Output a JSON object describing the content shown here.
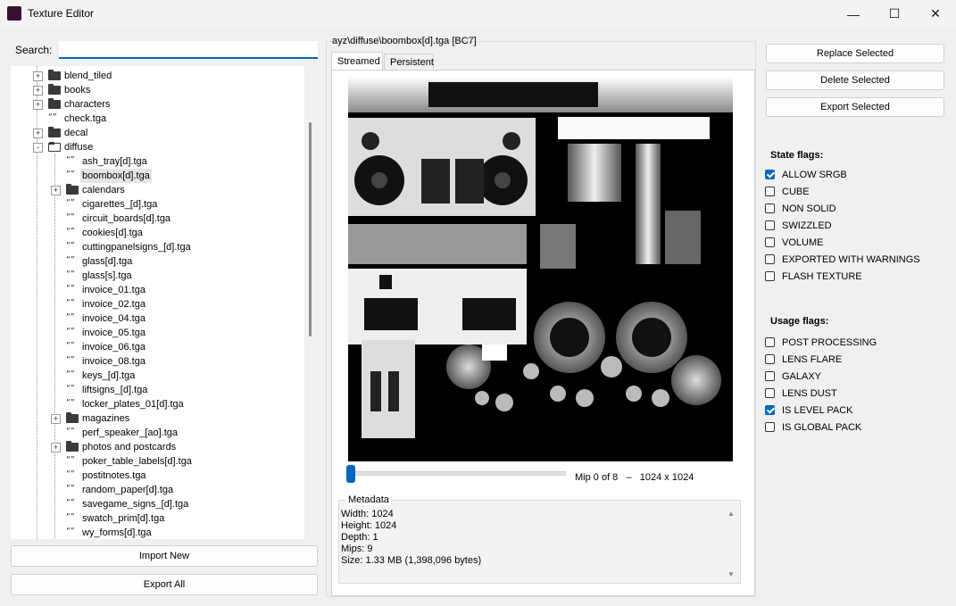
{
  "window": {
    "title": "Texture Editor",
    "minimize": "—",
    "maximize": "☐",
    "close": "✕"
  },
  "search": {
    "label": "Search:",
    "value": ""
  },
  "tree": [
    {
      "label": "blend_tiled",
      "type": "folder",
      "level": 1,
      "expander": "+"
    },
    {
      "label": "books",
      "type": "folder",
      "level": 1,
      "expander": "+"
    },
    {
      "label": "characters",
      "type": "folder",
      "level": 1,
      "expander": "+"
    },
    {
      "label": "check.tga",
      "type": "file",
      "level": 1
    },
    {
      "label": "decal",
      "type": "folder",
      "level": 1,
      "expander": "+"
    },
    {
      "label": "diffuse",
      "type": "folder-open",
      "level": 1,
      "expander": "-"
    },
    {
      "label": "ash_tray[d].tga",
      "type": "file",
      "level": 2
    },
    {
      "label": "boombox[d].tga",
      "type": "file",
      "level": 2,
      "selected": true
    },
    {
      "label": "calendars",
      "type": "folder",
      "level": 2,
      "expander": "+"
    },
    {
      "label": "cigarettes_[d].tga",
      "type": "file",
      "level": 2
    },
    {
      "label": "circuit_boards[d].tga",
      "type": "file",
      "level": 2
    },
    {
      "label": "cookies[d].tga",
      "type": "file",
      "level": 2
    },
    {
      "label": "cuttingpanelsigns_[d].tga",
      "type": "file",
      "level": 2
    },
    {
      "label": "glass[d].tga",
      "type": "file",
      "level": 2
    },
    {
      "label": "glass[s].tga",
      "type": "file",
      "level": 2
    },
    {
      "label": "invoice_01.tga",
      "type": "file",
      "level": 2
    },
    {
      "label": "invoice_02.tga",
      "type": "file",
      "level": 2
    },
    {
      "label": "invoice_04.tga",
      "type": "file",
      "level": 2
    },
    {
      "label": "invoice_05.tga",
      "type": "file",
      "level": 2
    },
    {
      "label": "invoice_06.tga",
      "type": "file",
      "level": 2
    },
    {
      "label": "invoice_08.tga",
      "type": "file",
      "level": 2
    },
    {
      "label": "keys_[d].tga",
      "type": "file",
      "level": 2
    },
    {
      "label": "liftsigns_[d].tga",
      "type": "file",
      "level": 2
    },
    {
      "label": "locker_plates_01[d].tga",
      "type": "file",
      "level": 2
    },
    {
      "label": "magazines",
      "type": "folder",
      "level": 2,
      "expander": "+"
    },
    {
      "label": "perf_speaker_[ao].tga",
      "type": "file",
      "level": 2
    },
    {
      "label": "photos and postcards",
      "type": "folder",
      "level": 2,
      "expander": "+"
    },
    {
      "label": "poker_table_labels[d].tga",
      "type": "file",
      "level": 2
    },
    {
      "label": "postitnotes.tga",
      "type": "file",
      "level": 2
    },
    {
      "label": "random_paper[d].tga",
      "type": "file",
      "level": 2
    },
    {
      "label": "savegame_signs_[d].tga",
      "type": "file",
      "level": 2
    },
    {
      "label": "swatch_prim[d].tga",
      "type": "file",
      "level": 2
    },
    {
      "label": "wy_forms[d].tga",
      "type": "file",
      "level": 2
    }
  ],
  "left_buttons": {
    "import": "Import New",
    "export_all": "Export All"
  },
  "preview": {
    "path": "ayz\\diffuse\\boombox[d].tga [BC7]",
    "tabs": [
      "Streamed",
      "Persistent"
    ],
    "mip_label": "Mip 0 of 8",
    "dash": "–",
    "dimensions": "1024 x 1024",
    "mip_level": 0,
    "mip_max": 8
  },
  "metadata": {
    "legend": "Metadata",
    "lines": [
      "Width: 1024",
      "Height: 1024",
      "Depth: 1",
      "Mips: 9",
      "Size: 1.33 MB (1,398,096 bytes)"
    ]
  },
  "actions": {
    "replace": "Replace Selected",
    "delete": "Delete Selected",
    "export": "Export Selected"
  },
  "state_flags": {
    "title": "State flags:",
    "items": [
      {
        "label": "ALLOW SRGB",
        "checked": true
      },
      {
        "label": "CUBE",
        "checked": false
      },
      {
        "label": "NON SOLID",
        "checked": false
      },
      {
        "label": "SWIZZLED",
        "checked": false
      },
      {
        "label": "VOLUME",
        "checked": false
      },
      {
        "label": "EXPORTED WITH WARNINGS",
        "checked": false
      },
      {
        "label": "FLASH TEXTURE",
        "checked": false
      }
    ]
  },
  "usage_flags": {
    "title": "Usage flags:",
    "items": [
      {
        "label": "POST PROCESSING",
        "checked": false
      },
      {
        "label": "LENS FLARE",
        "checked": false
      },
      {
        "label": "GALAXY",
        "checked": false
      },
      {
        "label": "LENS DUST",
        "checked": false
      },
      {
        "label": "IS LEVEL PACK",
        "checked": true
      },
      {
        "label": "IS GLOBAL PACK",
        "checked": false
      }
    ]
  },
  "colors": {
    "accent": "#0067c0"
  }
}
